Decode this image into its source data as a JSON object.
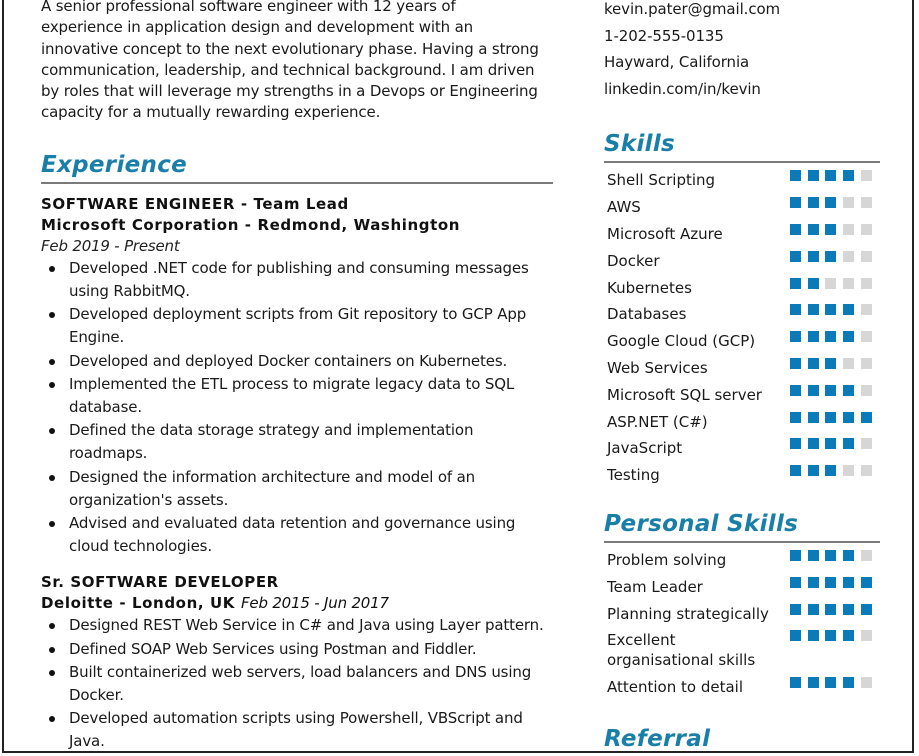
{
  "colors": {
    "accent": "#1a7fa8",
    "rating_filled": "#0a7bb8",
    "rating_empty": "#d6d6d6",
    "divider": "#7a7a7a"
  },
  "summary": "A senior professional software engineer with 12 years of experience in application design and development with an innovative concept to the next evolutionary phase.  Having a strong communication, leadership, and technical background. I am driven by roles that will leverage my strengths in a Devops or Engineering capacity for a mutually rewarding experience.",
  "summary_lines": [
    "A senior professional software engineer with 12 years of",
    "experience in application design and development with an",
    "innovative concept to the next evolutionary phase.  Having a strong",
    "communication, leadership, and technical background. I am driven",
    "by roles that will leverage my strengths in a Devops or Engineering",
    "capacity for a mutually rewarding experience."
  ],
  "contact": {
    "email": "kevin.pater@gmail.com",
    "phone": "1-202-555-0135",
    "location": "Hayward, California",
    "linkedin": "linkedin.com/in/kevin"
  },
  "experience": {
    "heading": "Experience",
    "jobs": [
      {
        "title": "SOFTWARE ENGINEER - Team Lead",
        "company": "Microsoft Corporation - Redmond, Washington",
        "dates": "Feb 2019 - Present",
        "bullets": [
          "Developed .NET code for publishing and consuming messages using RabbitMQ.",
          "Developed deployment scripts from Git repository to GCP App Engine.",
          "Developed and deployed Docker containers on Kubernetes.",
          "Implemented the ETL process to migrate legacy data to SQL database.",
          "Defined the data storage strategy and implementation roadmaps.",
          "Designed the information architecture and model of an organization's assets.",
          "Advised and evaluated data retention and governance using cloud technologies."
        ]
      },
      {
        "title": "Sr. SOFTWARE DEVELOPER",
        "company": "Deloitte - London, UK",
        "dates": "Feb 2015 - Jun 2017",
        "bullets": [
          "Designed REST Web Service in C# and Java using Layer pattern.",
          "Defined SOAP Web Services using Postman and Fiddler.",
          "Built containerized web servers, load balancers and DNS using Docker.",
          "Developed automation scripts using Powershell, VBScript and Java."
        ]
      }
    ]
  },
  "skills": {
    "heading": "Skills",
    "max": 5,
    "items": [
      {
        "name": "Shell Scripting",
        "level": 4
      },
      {
        "name": "AWS",
        "level": 3
      },
      {
        "name": "Microsoft Azure",
        "level": 3
      },
      {
        "name": "Docker",
        "level": 3
      },
      {
        "name": "Kubernetes",
        "level": 2
      },
      {
        "name": "Databases",
        "level": 4
      },
      {
        "name": "Google Cloud (GCP)",
        "level": 4
      },
      {
        "name": "Web Services",
        "level": 3
      },
      {
        "name": "Microsoft SQL server",
        "level": 4
      },
      {
        "name": "ASP.NET (C#)",
        "level": 5
      },
      {
        "name": "JavaScript",
        "level": 4
      },
      {
        "name": "Testing",
        "level": 3
      }
    ]
  },
  "personal_skills": {
    "heading": "Personal Skills",
    "max": 5,
    "items": [
      {
        "name": "Problem solving",
        "level": 4
      },
      {
        "name": "Team Leader",
        "level": 5
      },
      {
        "name": "Planning strategically",
        "level": 5
      },
      {
        "name": "Excellent organisational skills",
        "level": 4
      },
      {
        "name": "Attention to detail",
        "level": 4
      }
    ]
  },
  "referral": {
    "heading": "Referral"
  }
}
